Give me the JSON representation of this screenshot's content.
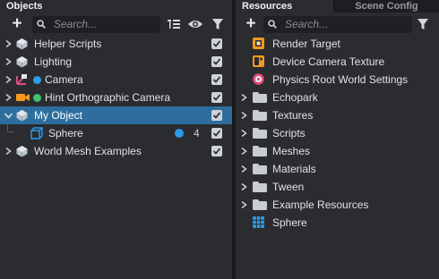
{
  "objects_panel": {
    "tab_label": "Objects",
    "search_placeholder": "Search...",
    "items": [
      {
        "label": "Helper Scripts",
        "icon": "scene-object-icon",
        "enabled": true
      },
      {
        "label": "Lighting",
        "icon": "scene-object-icon",
        "enabled": true
      },
      {
        "label": "Camera",
        "icon": "camera-object-icon",
        "enabled": true
      },
      {
        "label": "Hint Orthographic Camera",
        "icon": "orthographic-camera-icon",
        "enabled": true
      },
      {
        "label": "My Object",
        "icon": "scene-object-icon",
        "enabled": true,
        "selected": true
      },
      {
        "label": "Sphere",
        "icon": "mesh-cube-icon",
        "enabled": true,
        "count": "4"
      },
      {
        "label": "World Mesh Examples",
        "icon": "scene-object-icon",
        "enabled": true
      }
    ]
  },
  "resources_panel": {
    "tab_label": "Resources",
    "inactive_tab_label": "Scene Config",
    "search_placeholder": "Search...",
    "items": [
      {
        "label": "Render Target",
        "icon": "render-target-icon"
      },
      {
        "label": "Device Camera Texture",
        "icon": "device-camera-texture-icon"
      },
      {
        "label": "Physics Root World Settings",
        "icon": "physics-settings-icon"
      },
      {
        "label": "Echopark",
        "icon": "folder-icon"
      },
      {
        "label": "Textures",
        "icon": "folder-icon"
      },
      {
        "label": "Scripts",
        "icon": "folder-icon"
      },
      {
        "label": "Meshes",
        "icon": "folder-icon"
      },
      {
        "label": "Materials",
        "icon": "folder-icon"
      },
      {
        "label": "Tween",
        "icon": "folder-icon"
      },
      {
        "label": "Example Resources",
        "icon": "folder-icon"
      },
      {
        "label": "Sphere",
        "icon": "sphere-mesh-icon"
      }
    ]
  },
  "colors": {
    "selection": "#2d6e9e",
    "accent_blue": "#2e9bea",
    "accent_green": "#3ec46d",
    "accent_orange": "#f39a1f"
  }
}
